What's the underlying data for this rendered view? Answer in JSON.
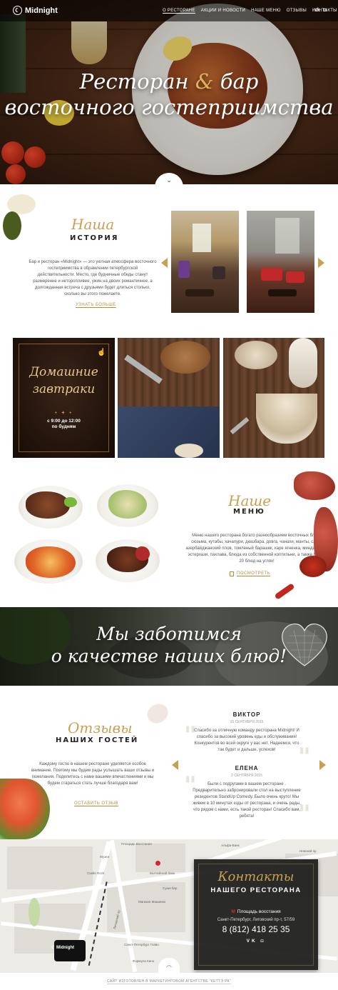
{
  "nav": {
    "logo": "Midnight",
    "items": [
      {
        "label": "О ресторане",
        "active": true
      },
      {
        "label": "Акции и новости",
        "active": false
      },
      {
        "label": "Наше меню",
        "active": false
      },
      {
        "label": "Отзывы",
        "active": false
      },
      {
        "label": "Контакты",
        "active": false
      }
    ],
    "social": [
      "vk-icon",
      "instagram-icon"
    ]
  },
  "hero": {
    "title_part1": "Ресторан",
    "title_amp": "&",
    "title_part2": "бар",
    "title_line2": "восточного гостеприимства"
  },
  "history": {
    "script": "Наша",
    "caps": "История",
    "text": "Бар и ресторан «Midnight» — это уютная атмосфера восточного гостеприимства в обрамлении петербургской действительности. Место, где будничные обеды станут размеренне и неторопливее, ужин на двоих романтичнее, а долгожданная встреча с друзьями будет длиться столько, сколько вы этого пожелаете.",
    "link": "Узнать больше"
  },
  "breakfast": {
    "title_line1": "Домашние",
    "title_line2": "завтраки",
    "time_line1": "с 9:00 до 12:00",
    "time_line2": "по будням"
  },
  "menu_section": {
    "script": "Наше",
    "caps": "Меню",
    "text": "Меню нашего ресторана богато разнообразием восточных блюд: сюзьма, кутабы, хачапури, дюшбара, довга, чанахи, манты, садж, азербайджанский плов, томленый барашек, каре ягненка, миндальный эстерхази, пахлава, блюда из собственной коптильни, а также более 20 блюд на углях!",
    "link": "Посмотреть"
  },
  "banner": {
    "line1": "Мы заботимся",
    "line2": "о качестве наших блюд!"
  },
  "reviews": {
    "script": "Отзывы",
    "caps": "наших гостей",
    "text": "Каждому гостю в нашем ресторане уделяется особое внимание. Поэтому мы будем рады услышать ваши отзывы и пожелания. Поделитесь с нами вашими впечатлениями и мы будем стараться стать лучше благодаря вам!",
    "link": "Оставить отзыв",
    "items": [
      {
        "name": "Виктор",
        "date": "15 сентября 2015",
        "body": "Спасибо за отличную команду ресторана Midnight! И спасибо за высокий уровень еды и обслуживания! Конкурентов во всей округе у вас нет. Надеемся, что так будет и дальше, успехов!"
      },
      {
        "name": "Елена",
        "date": "2 сентября 2015",
        "body": "Были с подругами в вашем ресторане . Предварительно забронировали стол на выступление резидентов StandUp Comedy. Было очень круто! Мы живем в 10 минутах езды от ресторана, и очень рады, что рядом с нами, есть такой ресторан! Спасибо вам, ребята!"
      }
    ]
  },
  "contacts": {
    "script": "Контакты",
    "caps": "нашего ресторана",
    "metro_icon": "М",
    "metro": "Площадь восстания",
    "address": "Санкт-Петербург, Лиговский пр-т, 57/59",
    "phone": "8 (812) 418 25 35",
    "social": "VK  ◘"
  },
  "map": {
    "pin_label": "Midnight",
    "labels": {
      "l1": "Площадь Восстания",
      "l2": "Альфа-Банк",
      "l3": "Музеи",
      "l4": "Castle Rock",
      "l5": "Балтийский банк",
      "l6": "Суши бар",
      "l7": "Магазин Машинки",
      "l8": "Санкт-Петербург Главн",
      "l9": "Формула Кино",
      "l10": "Невский пр",
      "l11": "Лиговский пр"
    }
  },
  "footer": {
    "text": "Сайт изготовлен в маркетинговом агентстве \"Кеттэ РА\""
  }
}
